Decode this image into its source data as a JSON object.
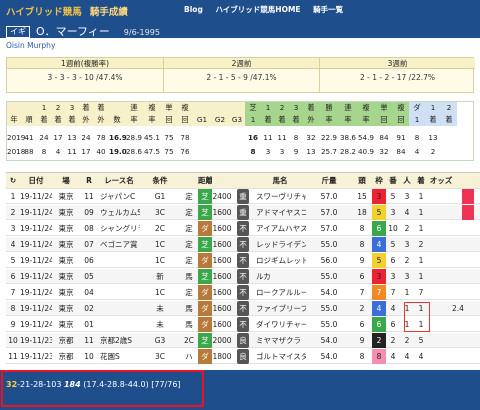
{
  "header": {
    "site": "ハイブリッド競馬",
    "sub": "騎手成績",
    "nav": [
      "Blog",
      "ハイブリッド競馬HOME",
      "騎手一覧"
    ],
    "flag": "イギ",
    "jockey": "O．マーフィー",
    "birth": "9/6-1995"
  },
  "english_name": "Oisin Murphy",
  "periods": [
    {
      "label": "1週前(複勝率)",
      "value": "3 - 3 - 3 - 10 /47.4%"
    },
    {
      "label": "2週前",
      "value": "2 - 1 - 5 - 9 /47.1%"
    },
    {
      "label": "3週前",
      "value": "2 - 1 - 2 - 17 /22.7%"
    }
  ],
  "stat_headers_top": [
    "",
    "",
    "1",
    "2",
    "3",
    "着",
    "着",
    "",
    "連",
    "複",
    "単",
    "複",
    "",
    "",
    "",
    "芝",
    "1",
    "2",
    "3",
    "着",
    "勝",
    "連",
    "複",
    "単",
    "複",
    "ダ",
    "1",
    "2"
  ],
  "stat_headers_bot": [
    "年",
    "順",
    "着",
    "着",
    "着",
    "外",
    "外",
    "数",
    "率",
    "率",
    "回",
    "回",
    "G1",
    "G2",
    "G3",
    "1",
    "着",
    "着",
    "着",
    "外",
    "率",
    "率",
    "率",
    "回",
    "回",
    "1",
    "着",
    "着"
  ],
  "stat_rows": [
    [
      "2019",
      "41",
      "24",
      "17",
      "13",
      "24",
      "78",
      "16.9",
      "28.9",
      "45.1",
      "75",
      "78",
      "",
      "",
      "",
      "16",
      "11",
      "11",
      "8",
      "32",
      "22.9",
      "38.6",
      "54.9",
      "84",
      "91",
      "8",
      "13"
    ],
    [
      "2018",
      "88",
      "8",
      "4",
      "11",
      "17",
      "40",
      "19.0",
      "28.6",
      "47.5",
      "75",
      "76",
      "",
      "",
      "",
      "8",
      "3",
      "3",
      "9",
      "13",
      "25.7",
      "28.2",
      "40.9",
      "32",
      "84",
      "4",
      "2"
    ]
  ],
  "table_headers": [
    "",
    "日付",
    "場",
    "R",
    "レース名",
    "条件",
    "",
    "距離",
    "",
    "",
    "馬名",
    "斤量",
    "頭",
    "枠",
    "番",
    "人",
    "着",
    "オッズ"
  ],
  "races": [
    [
      "1",
      "19-11/24",
      "東京",
      "11",
      "ジャパンC",
      "G1",
      "定",
      "芝",
      "2400",
      "重",
      "スワーヴリチャード",
      "57.0",
      "15",
      "3",
      "5",
      "3",
      "1"
    ],
    [
      "2",
      "19-11/24",
      "東京",
      "09",
      "ウェルカムS",
      "3C",
      "定",
      "芝",
      "1600",
      "重",
      "アドマイヤスコール",
      "57.0",
      "18",
      "5",
      "3",
      "4",
      "1"
    ],
    [
      "3",
      "19-11/24",
      "東京",
      "08",
      "シャングリラ",
      "2C",
      "定",
      "ダ",
      "1600",
      "不",
      "アイアムハヤスギル",
      "57.0",
      "8",
      "6",
      "10",
      "2",
      "1"
    ],
    [
      "4",
      "19-11/24",
      "東京",
      "07",
      "ベゴニア賞",
      "1C",
      "定",
      "芝",
      "1600",
      "不",
      "レッドライデン",
      "55.0",
      "8",
      "4",
      "5",
      "3",
      "2"
    ],
    [
      "5",
      "19-11/24",
      "東京",
      "06",
      "",
      "1C",
      "定",
      "ダ",
      "1600",
      "不",
      "ロジギムレット",
      "56.0",
      "9",
      "5",
      "6",
      "2",
      "1"
    ],
    [
      "6",
      "19-11/24",
      "東京",
      "05",
      "",
      "新",
      "馬",
      "芝",
      "1600",
      "不",
      "ルカ",
      "55.0",
      "6",
      "3",
      "3",
      "3",
      "1"
    ],
    [
      "7",
      "19-11/24",
      "東京",
      "04",
      "",
      "1C",
      "定",
      "ダ",
      "1600",
      "不",
      "ロークアルルージュ",
      "54.0",
      "7",
      "7",
      "7",
      "1",
      "7"
    ],
    [
      "8",
      "19-11/24",
      "東京",
      "02",
      "",
      "未",
      "馬",
      "ダ",
      "1600",
      "不",
      "ファイブリーフ",
      "55.0",
      "2",
      "4",
      "4",
      "1",
      "1"
    ],
    [
      "9",
      "19-11/24",
      "東京",
      "01",
      "",
      "未",
      "馬",
      "ダ",
      "1600",
      "不",
      "ダイワリチャード",
      "55.0",
      "6",
      "6",
      "6",
      "1",
      "1"
    ],
    [
      "10",
      "19-11/23",
      "京都",
      "11",
      "京都2歳S",
      "G3",
      "2C",
      "芝",
      "2000",
      "良",
      "ミヤマザクラ",
      "54.0",
      "9",
      "2",
      "2",
      "2",
      "5"
    ],
    [
      "11",
      "19-11/23",
      "京都",
      "10",
      "花園S",
      "3C",
      "ハ",
      "ダ",
      "1800",
      "良",
      "ゴルトマイスター",
      "54.0",
      "8",
      "8",
      "4",
      "4",
      "4"
    ]
  ],
  "odds_shown": [
    "2.4"
  ],
  "footer": {
    "bold": "32",
    "rest": "-21-28-103",
    "total": "184",
    "pct": "(17.4-28.8-44.0) [77/76]"
  }
}
